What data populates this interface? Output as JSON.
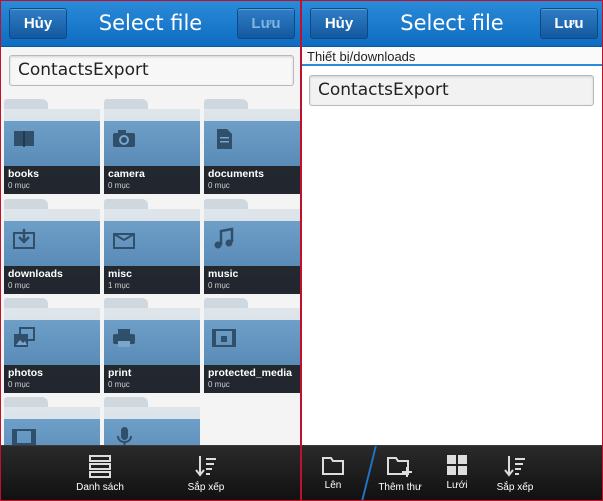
{
  "left": {
    "header": {
      "cancel_label": "Hủy",
      "title": "Select file",
      "save_label": "Lưu"
    },
    "filename_value": "ContactsExport",
    "folders": [
      {
        "name": "books",
        "count": "0 mục",
        "icon": "book-icon"
      },
      {
        "name": "camera",
        "count": "0 mục",
        "icon": "camera-icon"
      },
      {
        "name": "documents",
        "count": "0 mục",
        "icon": "document-icon"
      },
      {
        "name": "downloads",
        "count": "0 mục",
        "icon": "download-icon"
      },
      {
        "name": "misc",
        "count": "1 mục",
        "icon": "box-icon"
      },
      {
        "name": "music",
        "count": "0 mục",
        "icon": "music-note-icon"
      },
      {
        "name": "photos",
        "count": "0 mục",
        "icon": "photos-icon"
      },
      {
        "name": "print",
        "count": "0 mục",
        "icon": "printer-icon"
      },
      {
        "name": "protected_media",
        "count": "0 mục",
        "icon": "protected-media-icon"
      },
      {
        "name": "",
        "count": "",
        "icon": "film-icon"
      },
      {
        "name": "",
        "count": "",
        "icon": "microphone-icon"
      }
    ],
    "bottombar": {
      "list_label": "Danh sách",
      "sort_label": "Sắp xếp"
    }
  },
  "right": {
    "header": {
      "cancel_label": "Hủy",
      "title": "Select file",
      "save_label": "Lưu"
    },
    "breadcrumb": "Thiết bị/downloads",
    "filename_value": "ContactsExport",
    "bottombar": {
      "up_label": "Lên",
      "new_folder_label": "Thêm thư",
      "grid_label": "Lưới",
      "sort_label": "Sắp xếp"
    }
  }
}
